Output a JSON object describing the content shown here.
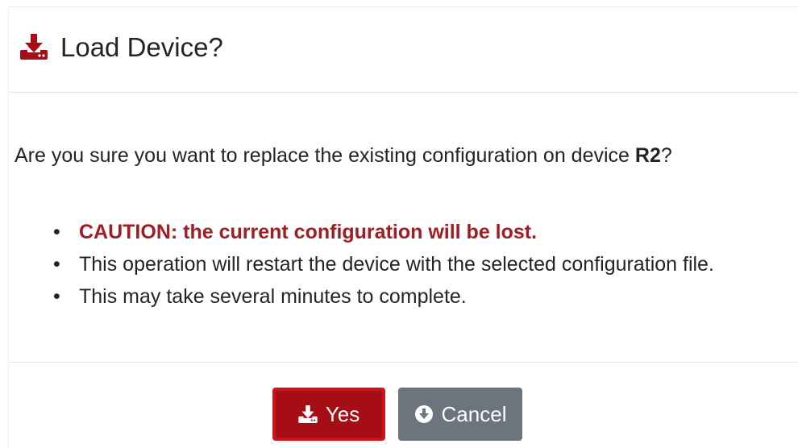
{
  "dialog": {
    "title": "Load Device?",
    "icon": "download-icon",
    "accent_color": "#a50e14"
  },
  "body": {
    "question_prefix": "Are you sure you want to replace the existing configuration on device ",
    "device_name": "R2",
    "question_suffix": "?",
    "bullets": [
      "CAUTION: the current configuration will be lost.",
      "This operation will restart the device with the selected configuration file.",
      "This may take several minutes to complete."
    ],
    "bullet_marker": "•",
    "caution_color": "#a11d21"
  },
  "footer": {
    "yes_label": "Yes",
    "yes_icon": "download-icon",
    "cancel_label": "Cancel",
    "cancel_icon": "circle-arrow-down-icon",
    "cancel_color": "#6c757d"
  }
}
